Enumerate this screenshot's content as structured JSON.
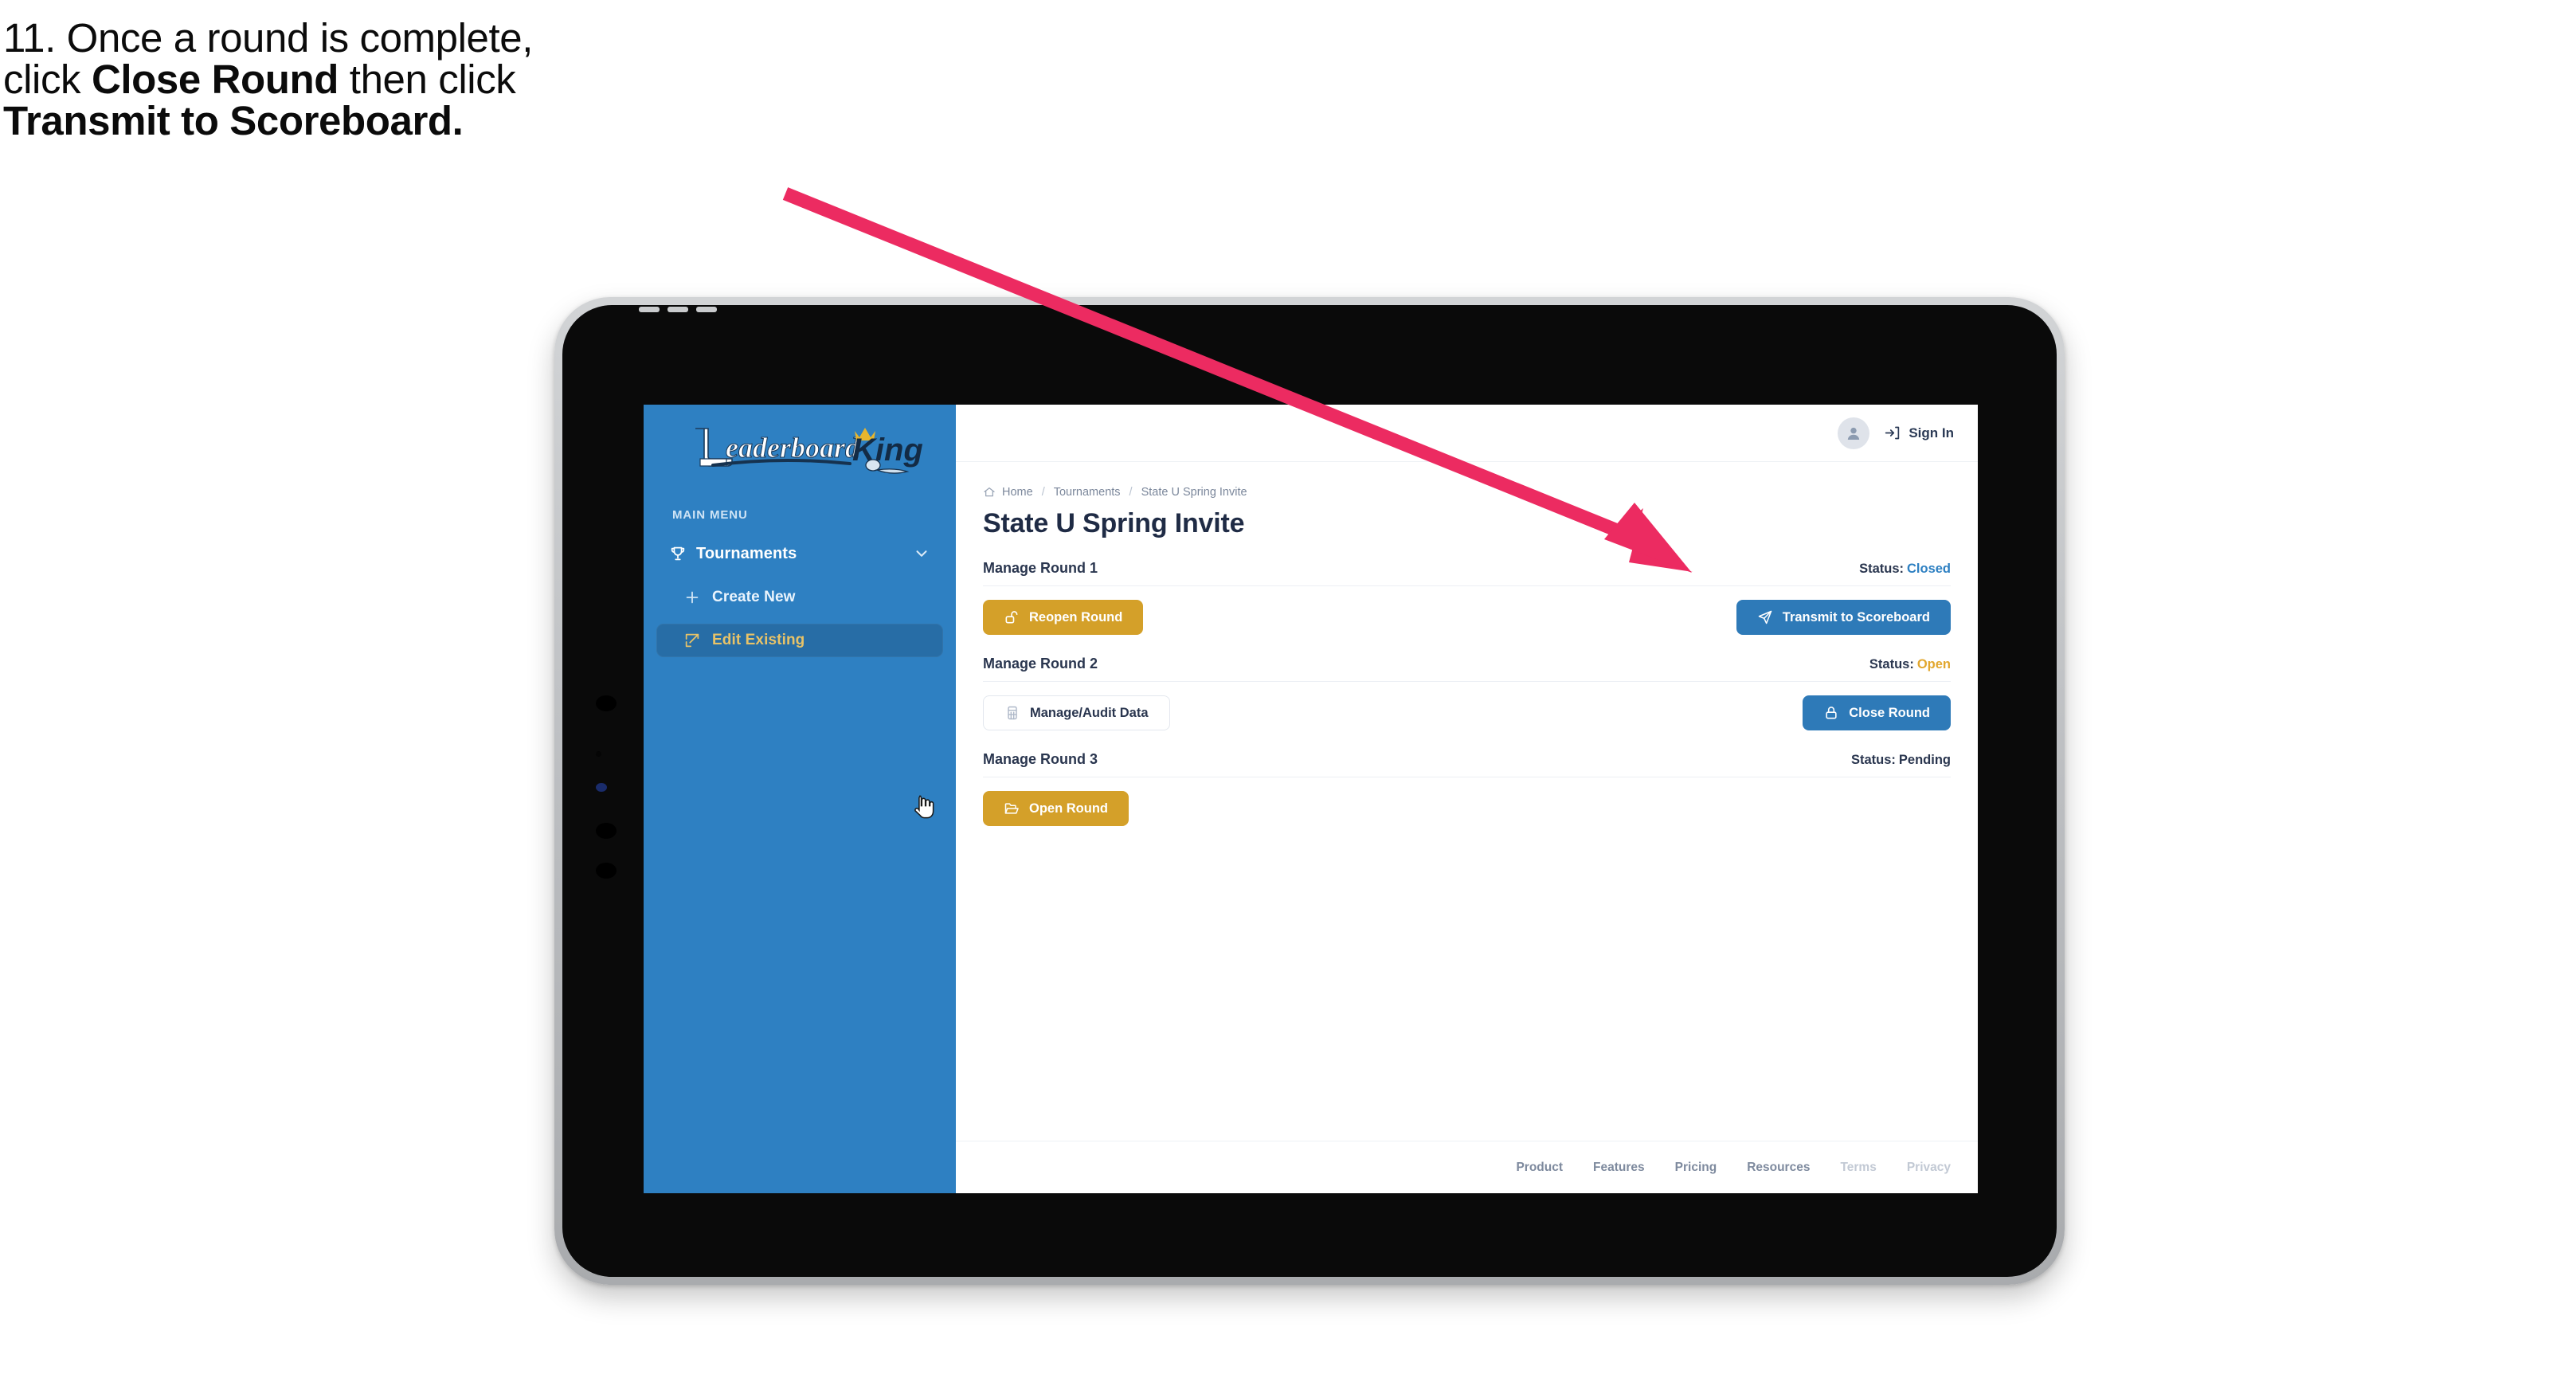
{
  "caption": {
    "line1": "11. Once a round is complete,",
    "line2_pre": "click ",
    "line2_bold": "Close Round",
    "line2_post": " then click",
    "line3_bold": "Transmit to Scoreboard."
  },
  "annotation": {
    "arrow_color": "#ec2b61"
  },
  "app": {
    "sidebar": {
      "logo_primary": "Leaderboard",
      "logo_secondary": "King",
      "section_label": "MAIN MENU",
      "items": [
        {
          "label": "Tournaments",
          "icon": "trophy-icon",
          "expand_icon": "chevron-down-icon",
          "active": false
        },
        {
          "label": "Create New",
          "icon": "plus-icon",
          "active": false
        },
        {
          "label": "Edit Existing",
          "icon": "edit-square-icon",
          "active": true
        }
      ]
    },
    "topbar": {
      "avatar_icon": "user-avatar-icon",
      "signin_label": "Sign In",
      "signin_icon": "sign-in-icon"
    },
    "breadcrumb": {
      "home_icon": "home-icon",
      "items": [
        "Home",
        "Tournaments",
        "State U Spring Invite"
      ],
      "separator": "/"
    },
    "page_title": "State U Spring Invite",
    "status_label": "Status:",
    "rounds": [
      {
        "title": "Manage Round 1",
        "status_value": "Closed",
        "status_class": "closed",
        "left_button": {
          "label": "Reopen Round",
          "style": "gold",
          "icon": "unlock-icon"
        },
        "right_button": {
          "label": "Transmit to Scoreboard",
          "style": "blue",
          "icon": "send-icon"
        }
      },
      {
        "title": "Manage Round 2",
        "status_value": "Open",
        "status_class": "open",
        "left_button": {
          "label": "Manage/Audit Data",
          "style": "ghost",
          "icon": "table-grid-icon"
        },
        "right_button": {
          "label": "Close Round",
          "style": "blue",
          "icon": "lock-icon"
        }
      },
      {
        "title": "Manage Round 3",
        "status_value": "Pending",
        "status_class": "pending",
        "left_button": {
          "label": "Open Round",
          "style": "gold",
          "icon": "folder-open-icon"
        },
        "right_button": null
      }
    ],
    "footer": {
      "links": [
        {
          "label": "Product",
          "muted": false
        },
        {
          "label": "Features",
          "muted": false
        },
        {
          "label": "Pricing",
          "muted": false
        },
        {
          "label": "Resources",
          "muted": false
        },
        {
          "label": "Terms",
          "muted": true
        },
        {
          "label": "Privacy",
          "muted": true
        }
      ]
    }
  },
  "colors": {
    "sidebar_blue": "#2e80c2",
    "sidebar_active": "#276da6",
    "gold": "#d4a029",
    "button_blue": "#2e7ab8",
    "navy_text": "#2a364f",
    "arrow_pink": "#ec2b61"
  }
}
